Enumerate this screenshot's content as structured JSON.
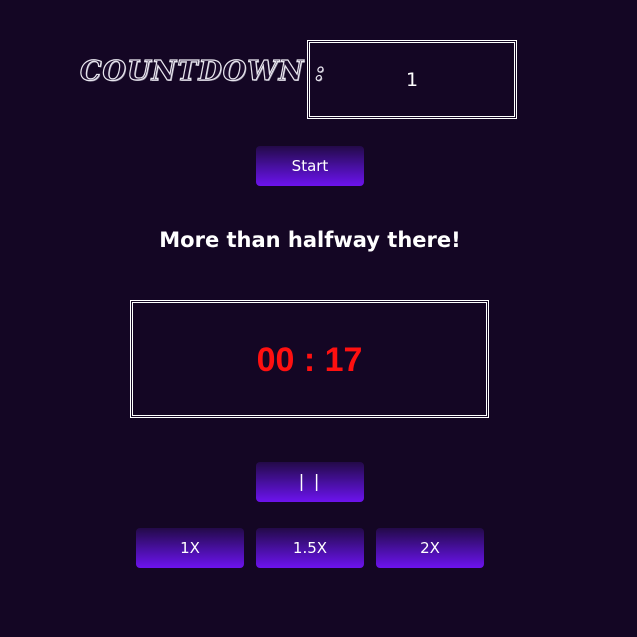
{
  "countdown": {
    "label": "COUNTDOWN :",
    "input_value": "1"
  },
  "controls": {
    "start_label": "Start",
    "pause_label": "| |"
  },
  "status": {
    "message": "More than halfway there!"
  },
  "timer": {
    "display": "00 : 17"
  },
  "speed": {
    "options": [
      "1X",
      "1.5X",
      "2X"
    ]
  },
  "colors": {
    "background": "#140624",
    "button_gradient_top": "#230a48",
    "button_gradient_bottom": "#6d12ee",
    "timer_text": "#ff1010",
    "text": "#ffffff"
  }
}
